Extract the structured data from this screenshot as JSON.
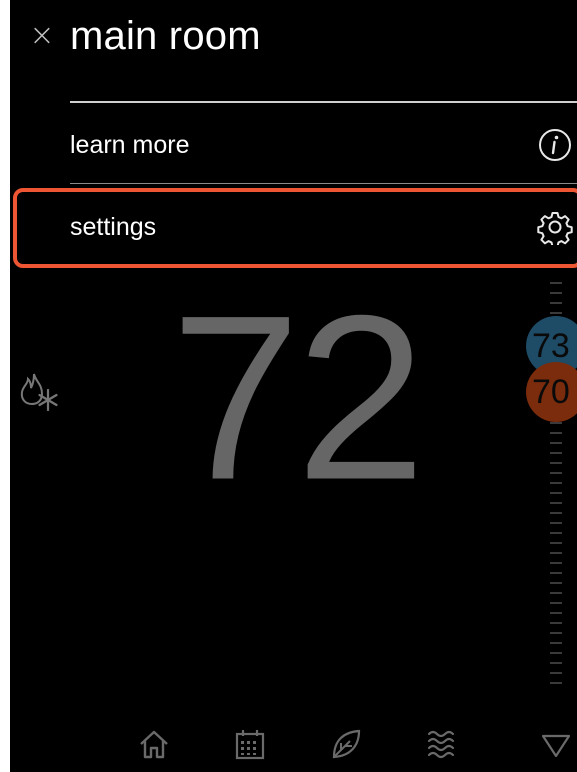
{
  "header": {
    "title": "main room",
    "close_icon": "close-icon"
  },
  "menu": {
    "items": [
      {
        "label": "learn more",
        "icon": "info-icon"
      },
      {
        "label": "settings",
        "icon": "gear-icon",
        "highlighted": true
      }
    ]
  },
  "thermostat": {
    "current_temp": "72",
    "cool_setpoint": "73",
    "heat_setpoint": "70",
    "mode_icon": "heat-cool-icon"
  },
  "nav": {
    "items": [
      "home-icon",
      "calendar-icon",
      "leaf-icon",
      "humidity-icon",
      "chevron-down-icon"
    ]
  },
  "colors": {
    "background": "#000000",
    "highlight": "#ee5533",
    "cool": "#1e4b66",
    "heat": "#7a2c0c",
    "text": "#ffffff"
  }
}
